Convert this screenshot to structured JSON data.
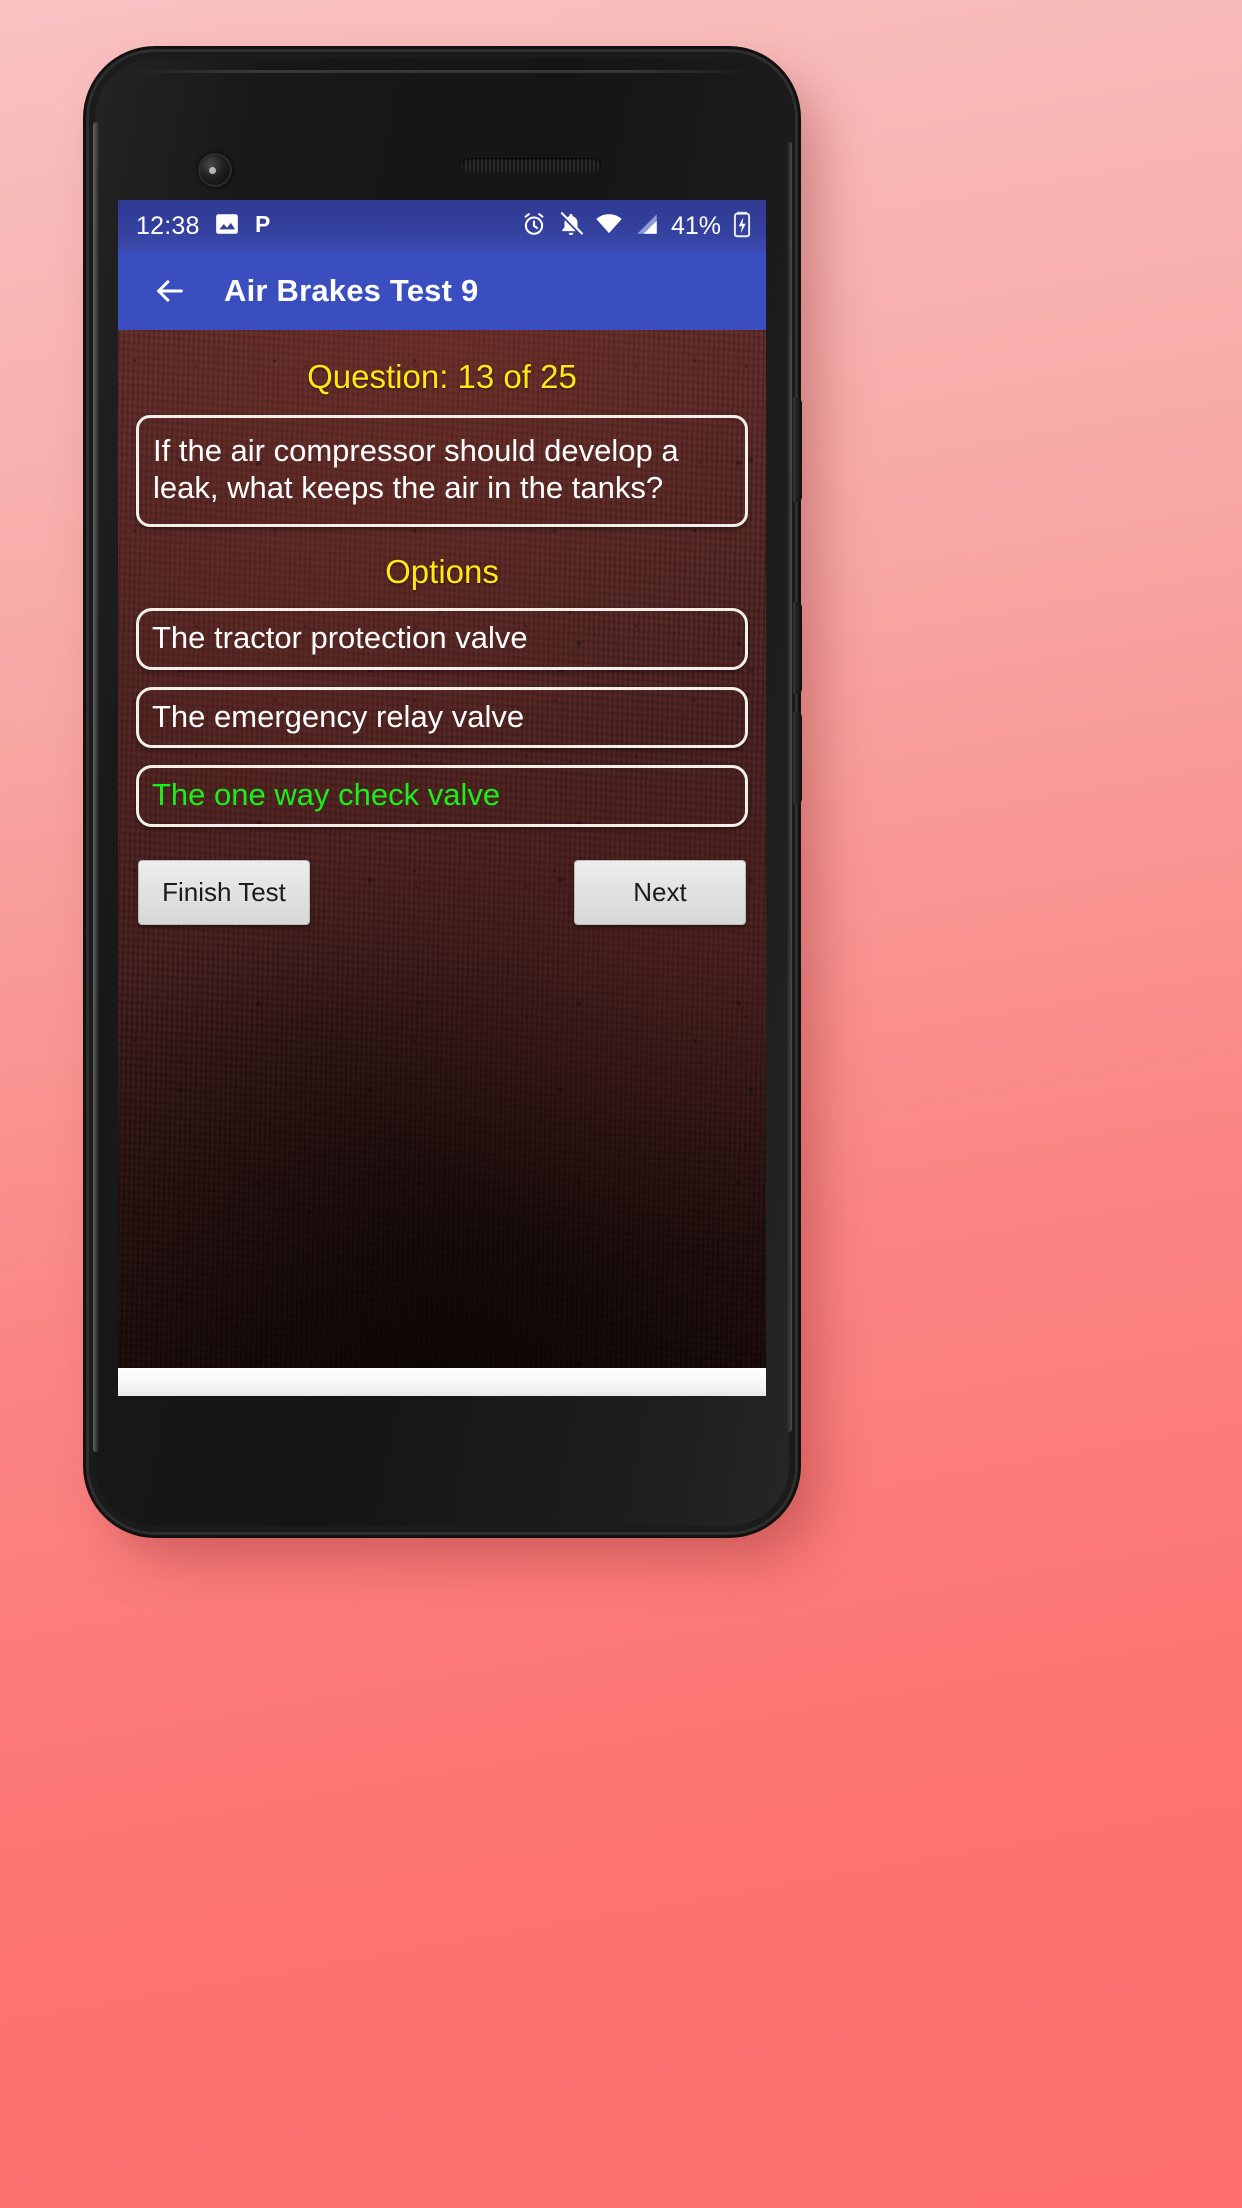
{
  "device": {
    "name": "android-phone",
    "hardware": {
      "front_camera": "camera-icon",
      "earpiece": "speaker-grille",
      "proximity_sensor": "proximity-sensor",
      "power_button": "power-button",
      "volume_up": "volume-up-button",
      "volume_down": "volume-down-button"
    }
  },
  "colors": {
    "status_bar": "#33409d",
    "app_bar": "#3b4ec0",
    "accent_yellow": "#ffe815",
    "selected_green": "#19f019",
    "card_border": "#f2eee8",
    "content_bg": "#4a2320",
    "button_face": "#e2e3e3"
  },
  "status_bar": {
    "clock": "12:38",
    "battery_percent": "41%",
    "left_icons": [
      "image-icon",
      "p-app-icon"
    ],
    "right_icons": [
      "alarm-clock-icon",
      "notifications-muted-icon",
      "wifi-icon",
      "cellular-signal-icon",
      "battery-charging-icon"
    ]
  },
  "app_bar": {
    "back_icon": "back-arrow-icon",
    "title": "Air Brakes Test 9"
  },
  "quiz": {
    "counter": "Question: 13 of 25",
    "question_number": 13,
    "question_total": 25,
    "question": "If the air compressor should develop a leak, what keeps the air in the tanks?",
    "options_label": "Options",
    "options": [
      {
        "text": "The tractor protection valve",
        "selected": false
      },
      {
        "text": "The emergency relay valve",
        "selected": false
      },
      {
        "text": "The one way check valve",
        "selected": true
      }
    ]
  },
  "buttons": {
    "finish": "Finish Test",
    "next": "Next"
  }
}
